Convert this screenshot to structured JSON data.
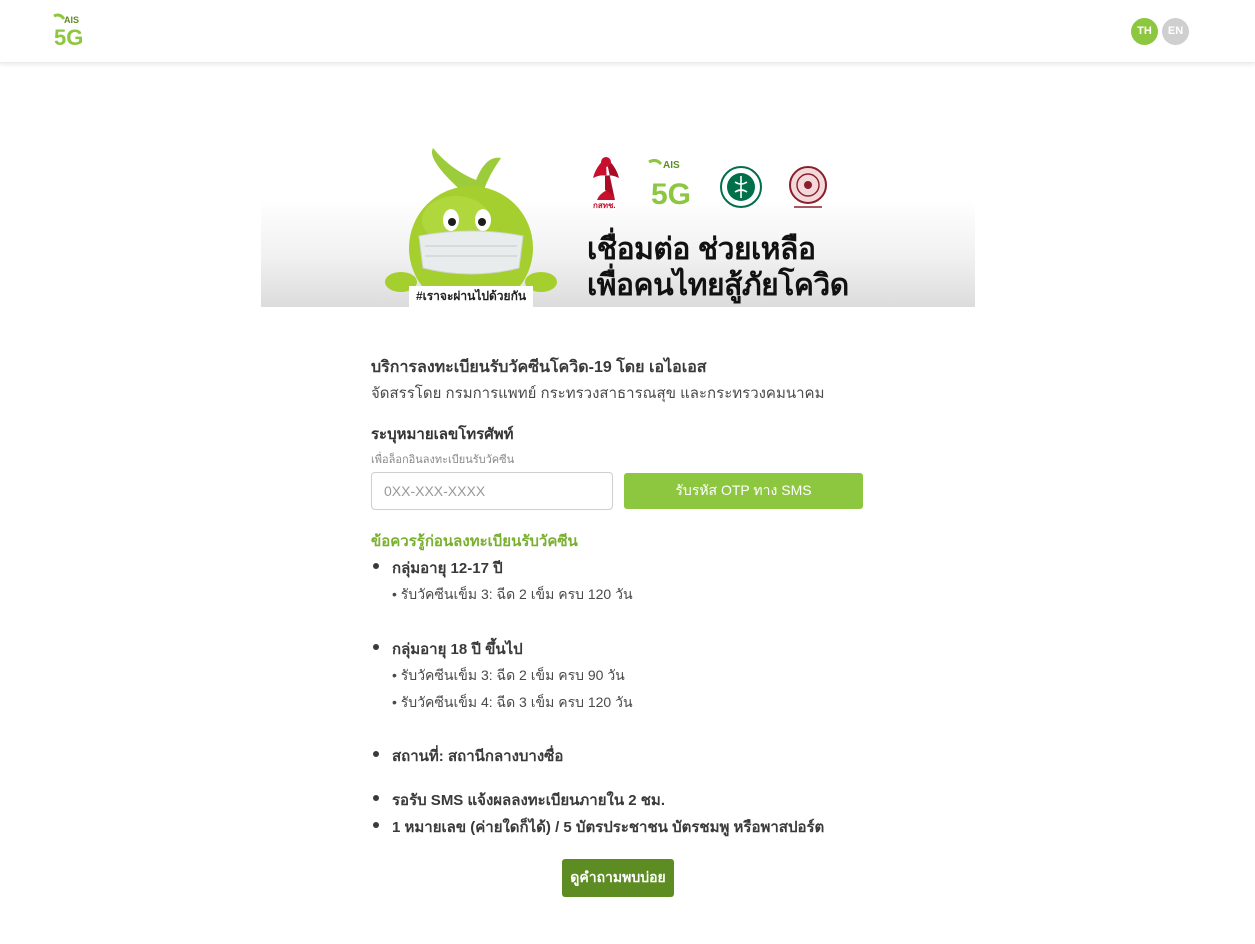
{
  "header": {
    "logo_brand": "AIS",
    "logo_5g": "5G",
    "lang_th": "TH",
    "lang_en": "EN"
  },
  "banner": {
    "headline_line1": "เชื่อมต่อ ช่วยเหลือ",
    "headline_line2": "เพื่อคนไทยสู้ภัยโควิด",
    "hashtag": "#เราจะผ่านไปด้วยกัน",
    "partner_logo_text": "กสทช.",
    "ais_logo_brand": "AIS",
    "ais_logo_5g": "5G"
  },
  "content": {
    "title": "บริการลงทะเบียนรับวัคซีนโควิด-19 โดย เอไอเอส",
    "subtitle": "จัดสรรโดย กรมการแพทย์ กระทรวงสาธารณสุข และกระทรวงคมนาคม",
    "phone_label": "ระบุหมายเลขโทรศัพท์",
    "phone_help": "เพื่อล็อกอินลงทะเบียนรับวัคซีน",
    "phone_placeholder": "0XX-XXX-XXXX",
    "otp_button": "รับรหัส OTP ทาง SMS",
    "info_heading": "ข้อควรรู้ก่อนลงทะเบียนรับวัคซีน",
    "group1_title": "กลุ่มอายุ 12-17 ปี",
    "group1_items": [
      "• รับวัคซีนเข็ม 3: ฉีด 2 เข็ม ครบ 120 วัน"
    ],
    "group2_title": "กลุ่มอายุ 18 ปี ขึ้นไป",
    "group2_items": [
      "• รับวัคซีนเข็ม 3: ฉีด 2 เข็ม ครบ 90 วัน",
      "• รับวัคซีนเข็ม 4: ฉีด 3 เข็ม ครบ 120 วัน"
    ],
    "location": "สถานที่: สถานีกลางบางซื่อ",
    "sms_notice": "รอรับ SMS แจ้งผลลงทะเบียนภายใน 2 ชม.",
    "id_notice": "1 หมายเลข (ค่ายใดก็ได้) / 5 บัตรประชาชน บัตรชมพู หรือพาสปอร์ต",
    "faq_button": "ดูคำถามพบบ่อย"
  },
  "colors": {
    "brand_green": "#8dc63f",
    "dark_green": "#5d8c23",
    "heading_green": "#7ab030"
  }
}
